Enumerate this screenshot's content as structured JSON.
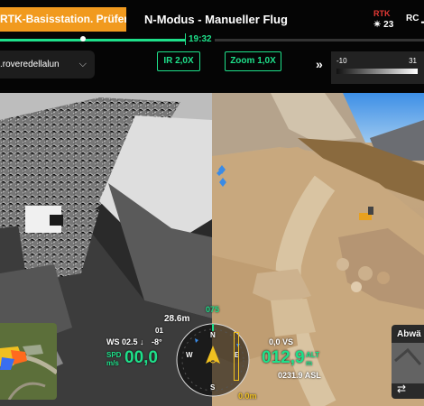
{
  "topbar": {
    "warning": "RTK-Basisstation. Prüfen, c",
    "mode_title": "N-Modus - Manueller Flug",
    "rtk_label": "RTK",
    "satellites": "23",
    "rc_label": "RC"
  },
  "timeline": {
    "time": "19:32",
    "progress": 0.44
  },
  "location_select": {
    "value": ".roveredellalun"
  },
  "zoom": {
    "ir_label": "IR 2,0X",
    "zoom_label": "Zoom 1,0X"
  },
  "thermal_scale": {
    "min": "-10",
    "max": "31"
  },
  "hud": {
    "distance": "28.6m",
    "heading": "075",
    "ws": "WS 02.5 ↓",
    "ws_small": "01",
    "pitch": "-8°",
    "spd_label": "SPD",
    "spd_unit": "m/s",
    "speed": "00,0",
    "vs": "0,0 VS",
    "altitude": "012,9",
    "alt_label": "ALT",
    "alt_unit": "m",
    "asl": "0231.9 ASL",
    "bottom_distance": "0.0m",
    "compass_n": "N",
    "compass_e": "E",
    "compass_s": "S",
    "compass_w": "W"
  },
  "pip": {
    "label": "Abwä"
  },
  "colors": {
    "accent": "#1ee08a",
    "warning": "#f19a1e",
    "rtk": "#e53935"
  },
  "icons": [
    "satellite-icon",
    "signal-icon",
    "chevron-down-icon",
    "double-arrow-icon",
    "drone-icon",
    "swap-icon"
  ]
}
